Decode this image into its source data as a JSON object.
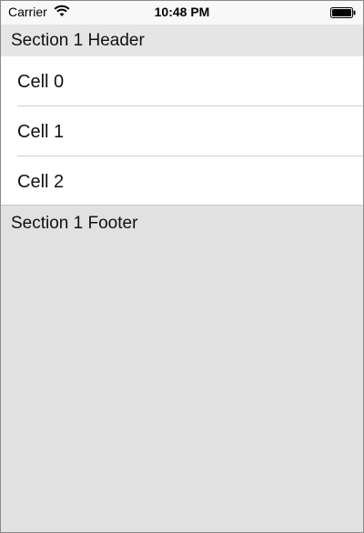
{
  "status_bar": {
    "carrier": "Carrier",
    "time": "10:48 PM",
    "wifi_icon": "wifi-icon",
    "battery_icon": "battery-full-icon"
  },
  "section": {
    "header": "Section 1 Header",
    "footer": "Section 1 Footer",
    "cells": [
      {
        "label": "Cell 0"
      },
      {
        "label": "Cell 1"
      },
      {
        "label": "Cell 2"
      }
    ]
  },
  "colors": {
    "background": "#e1e1e1",
    "header_background": "#e5e5e5",
    "cell_background": "#ffffff",
    "separator": "#cfcfcf",
    "text": "#111111"
  }
}
